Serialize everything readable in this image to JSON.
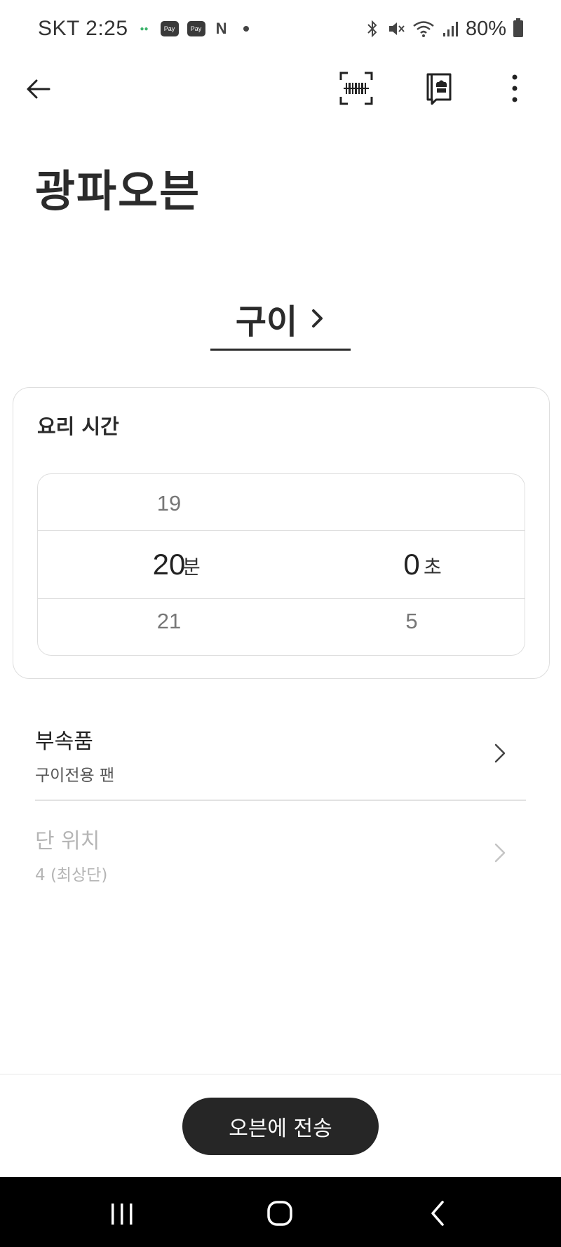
{
  "status_bar": {
    "carrier_time": "SKT 2:25",
    "left_icons": [
      "app-icon",
      "pay-icon",
      "pay-icon",
      "nfc-icon"
    ],
    "battery": "80%"
  },
  "app_bar": {
    "back_icon": "arrow-left-icon",
    "scan_icon": "barcode-scan-icon",
    "recipe_icon": "chef-book-icon",
    "more_icon": "more-vertical-icon"
  },
  "page_title": "광파오븐",
  "mode": {
    "label": "구이"
  },
  "cook_time": {
    "title": "요리 시간",
    "minutes": {
      "prev": "19",
      "selected": "20",
      "next": "21",
      "unit": "분"
    },
    "seconds": {
      "prev": "",
      "selected": "0",
      "next": "5",
      "unit": "초"
    }
  },
  "options": [
    {
      "title": "부속품",
      "value": "구이전용 팬",
      "enabled": true
    },
    {
      "title": "단 위치",
      "value": "4 (최상단)",
      "enabled": false
    }
  ],
  "send_button": "오븐에 전송",
  "nav": {
    "recents_icon": "recents-icon",
    "home_icon": "home-icon",
    "back_icon": "back-icon"
  },
  "colors": {
    "primary_text": "#2b2b2b",
    "button_bg": "#262626",
    "disabled_text": "#b5b5b5",
    "border": "#dedede"
  }
}
